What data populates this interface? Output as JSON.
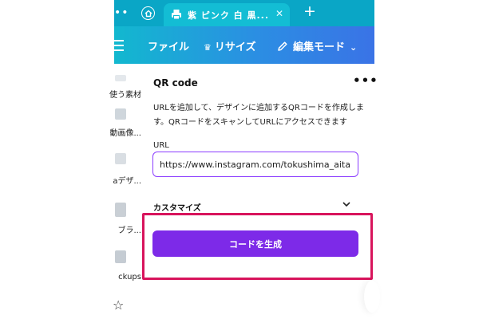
{
  "browser": {
    "tab_title": "紫 ピンク 白 黒...",
    "tab_close": "✕",
    "new_tab": "+",
    "overflow_dots": "••"
  },
  "toolbar": {
    "file_label": "ファイル",
    "resize_label": "リサイズ",
    "edit_mode_label": "編集モード"
  },
  "rail": {
    "items": [
      {
        "label": "使う素材"
      },
      {
        "label": "動画像..."
      },
      {
        "label": "aデザ..."
      },
      {
        "label": "ブラ..."
      },
      {
        "label": "ckups"
      }
    ]
  },
  "panel": {
    "title": "QR code",
    "more": "•••",
    "description": "URLを追加して、デザインに追加するQRコードを作成します。QRコードをスキャンしてURLにアクセスできます",
    "url_label": "URL",
    "url_value": "https://www.instagram.com/tokushima_aita",
    "customize_label": "カスタマイズ",
    "generate_label": "コードを生成"
  },
  "colors": {
    "accent_purple": "#7d2ae8",
    "highlight_pink": "#d8145c",
    "toolbar_teal": "#12b8cf",
    "toolbar_blue": "#3a73e6"
  }
}
